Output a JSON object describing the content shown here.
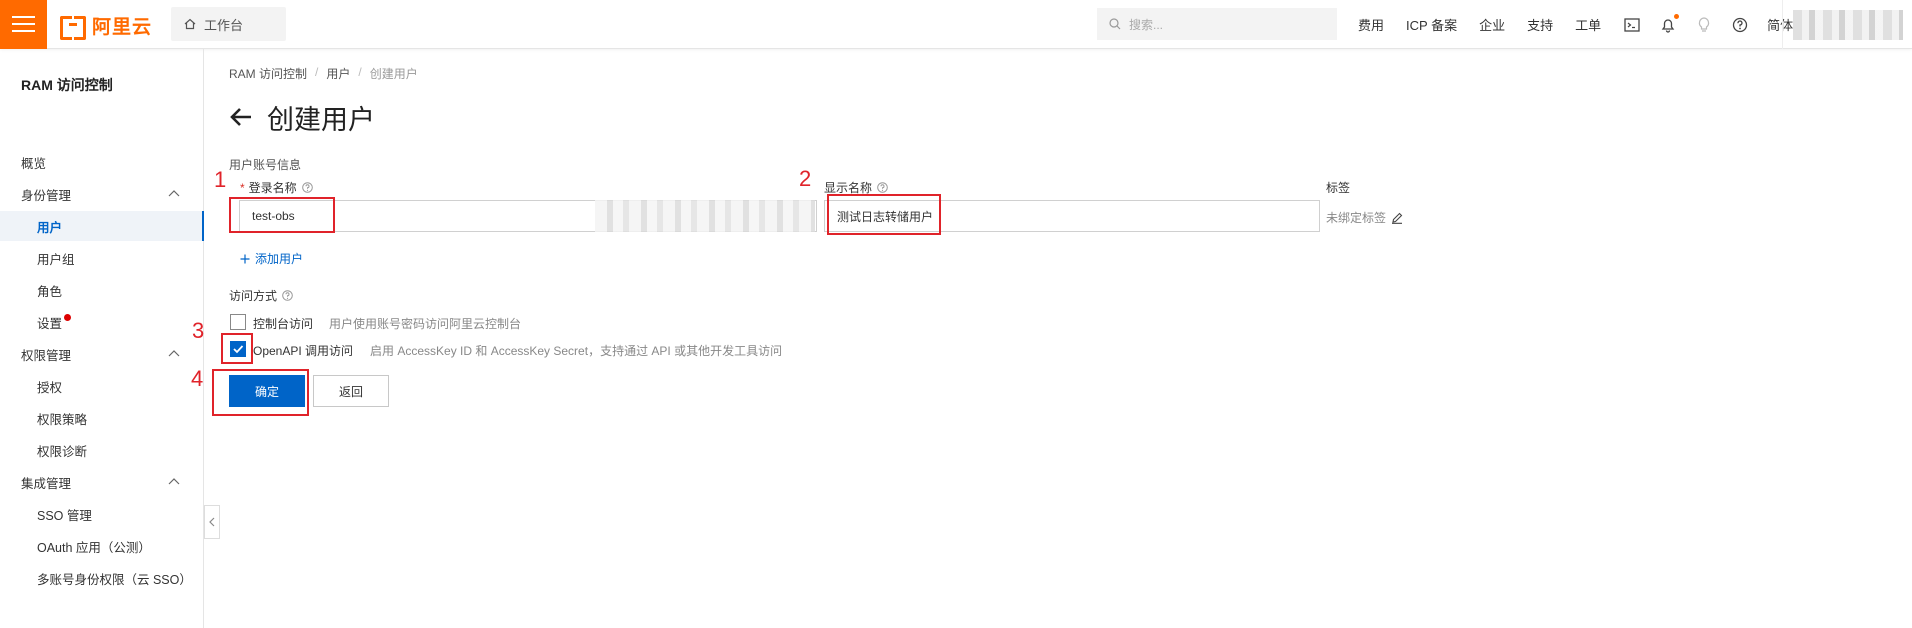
{
  "colors": {
    "brand": "#ff6a00",
    "primary": "#0064c8",
    "annotation": "#e0232a",
    "alert_dot": "#dd0000"
  },
  "header": {
    "logo_text": "阿里云",
    "workbench": "工作台",
    "search_placeholder": "搜索...",
    "links": [
      "费用",
      "ICP 备案",
      "企业",
      "支持",
      "工单"
    ],
    "icons": [
      "terminal-icon",
      "bell-icon",
      "bulb-icon",
      "help-circle-icon"
    ],
    "language": "简体"
  },
  "sidebar": {
    "title": "RAM 访问控制",
    "items": [
      {
        "label": "概览",
        "level": "top"
      },
      {
        "label": "身份管理",
        "level": "top",
        "expanded": true
      },
      {
        "label": "用户",
        "level": "sub",
        "active": true
      },
      {
        "label": "用户组",
        "level": "sub"
      },
      {
        "label": "角色",
        "level": "sub"
      },
      {
        "label": "设置",
        "level": "sub",
        "dot": true
      },
      {
        "label": "权限管理",
        "level": "top",
        "expanded": true
      },
      {
        "label": "授权",
        "level": "sub"
      },
      {
        "label": "权限策略",
        "level": "sub"
      },
      {
        "label": "权限诊断",
        "level": "sub"
      },
      {
        "label": "集成管理",
        "level": "top",
        "expanded": true
      },
      {
        "label": "SSO 管理",
        "level": "sub"
      },
      {
        "label": "OAuth 应用（公测）",
        "level": "sub"
      },
      {
        "label": "多账号身份权限（云 SSO）",
        "level": "sub"
      }
    ]
  },
  "breadcrumb": [
    "RAM 访问控制",
    "用户",
    "创建用户"
  ],
  "page": {
    "title": "创建用户",
    "account_section": "用户账号信息",
    "login_label": "登录名称",
    "login_value": "test-obs",
    "display_label": "显示名称",
    "display_value": "测试日志转储用户",
    "tag_label": "标签",
    "tag_value": "未绑定标签",
    "add_user": "添加用户",
    "access_section": "访问方式",
    "options": [
      {
        "label": "控制台访问",
        "desc": "用户使用账号密码访问阿里云控制台",
        "checked": false
      },
      {
        "label": "OpenAPI 调用访问",
        "desc": "启用 AccessKey ID 和 AccessKey Secret，支持通过 API 或其他开发工具访问",
        "checked": true
      }
    ],
    "confirm": "确定",
    "back": "返回"
  },
  "annotations": [
    "1",
    "2",
    "3",
    "4"
  ]
}
